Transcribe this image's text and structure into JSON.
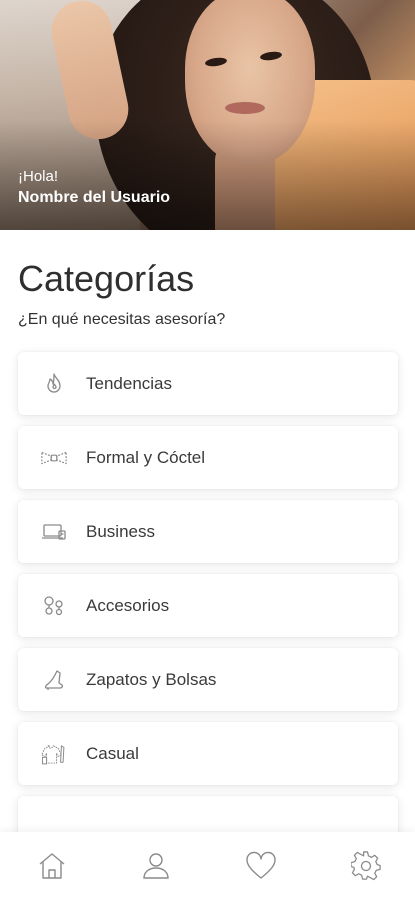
{
  "hero": {
    "greeting": "¡Hola!",
    "user_name": "Nombre del Usuario"
  },
  "header": {
    "title": "Categorías",
    "subtitle": "¿En qué necesitas asesoría?"
  },
  "categories": [
    {
      "label": "Tendencias",
      "icon": "flame-icon"
    },
    {
      "label": "Formal y Cóctel",
      "icon": "bowtie-icon"
    },
    {
      "label": "Business",
      "icon": "laptop-icon"
    },
    {
      "label": "Accesorios",
      "icon": "earrings-icon"
    },
    {
      "label": "Zapatos y Bolsas",
      "icon": "high-heel-icon"
    },
    {
      "label": "Casual",
      "icon": "shirt-icon"
    }
  ],
  "bottom_nav": [
    {
      "icon": "home-icon"
    },
    {
      "icon": "user-icon"
    },
    {
      "icon": "heart-icon"
    },
    {
      "icon": "gear-icon"
    }
  ],
  "colors": {
    "text": "#2b2b2b",
    "icon": "#8a8a8a",
    "background": "#ffffff"
  }
}
